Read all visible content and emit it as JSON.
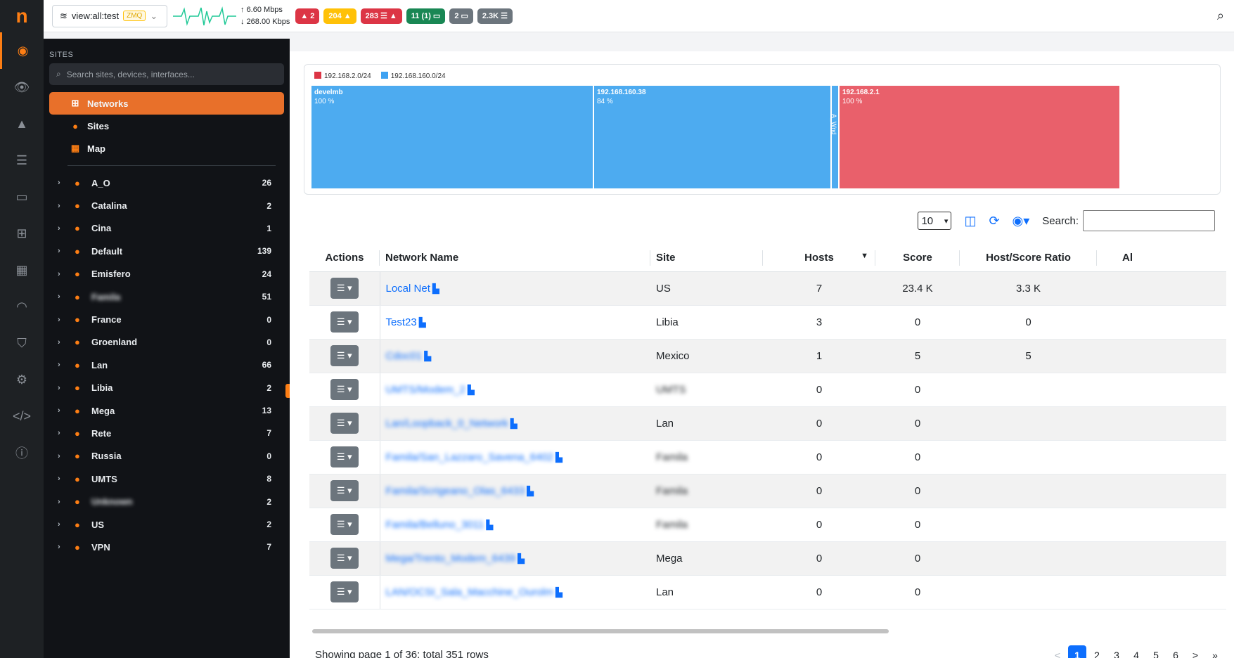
{
  "app": {
    "logo": "n"
  },
  "topbar": {
    "view": "view:all:test",
    "zmq": "ZMQ",
    "upload": "6.60 Mbps",
    "download": "268.00 Kbps",
    "badges": [
      "2",
      "204",
      "283",
      "11 (1)",
      "2",
      "2.3K"
    ]
  },
  "sidebar": {
    "title": "SITES",
    "search_placeholder": "Search sites, devices, interfaces...",
    "menu": [
      {
        "label": "Networks",
        "icon": "network-icon"
      },
      {
        "label": "Sites",
        "icon": "location-icon"
      },
      {
        "label": "Map",
        "icon": "map-icon"
      }
    ],
    "sites": [
      {
        "name": "A_O",
        "count": "26"
      },
      {
        "name": "Catalina",
        "count": "2"
      },
      {
        "name": "Cina",
        "count": "1"
      },
      {
        "name": "Default",
        "count": "139"
      },
      {
        "name": "Emisfero",
        "count": "24"
      },
      {
        "name": "Famila",
        "count": "51",
        "blurred": true
      },
      {
        "name": "France",
        "count": "0"
      },
      {
        "name": "Groenland",
        "count": "0"
      },
      {
        "name": "Lan",
        "count": "66"
      },
      {
        "name": "Libia",
        "count": "2"
      },
      {
        "name": "Mega",
        "count": "13"
      },
      {
        "name": "Rete",
        "count": "7"
      },
      {
        "name": "Russia",
        "count": "0"
      },
      {
        "name": "UMTS",
        "count": "8"
      },
      {
        "name": "Unknown",
        "count": "2",
        "blurred": true
      },
      {
        "name": "US",
        "count": "2"
      },
      {
        "name": "VPN",
        "count": "7"
      }
    ]
  },
  "treemap": {
    "legend": [
      {
        "label": "192.168.2.0/24",
        "color": "#dc3545"
      },
      {
        "label": "192.168.160.0/24",
        "color": "#3ea2f2"
      }
    ],
    "cells": [
      {
        "name": "develmb",
        "pct": "100 %",
        "color": "#4dabf0"
      },
      {
        "name": "192.168.160.38",
        "pct": "84 %",
        "color": "#4dabf0"
      },
      {
        "name": "A_Wnd",
        "pct": "",
        "color": "#4dabf0"
      },
      {
        "name": "192.168.2.1",
        "pct": "100 %",
        "color": "#e9606b"
      }
    ]
  },
  "controls": {
    "page_size": "10",
    "search_label": "Search:"
  },
  "table": {
    "headers": [
      "Actions",
      "Network Name",
      "Site",
      "Hosts",
      "Score",
      "Host/Score Ratio",
      "Al"
    ],
    "rows": [
      {
        "name": "Local Net",
        "site": "US",
        "hosts": "7",
        "score": "23.4 K",
        "ratio": "3.3 K"
      },
      {
        "name": "Test23",
        "site": "Libia",
        "hosts": "3",
        "score": "0",
        "ratio": "0"
      },
      {
        "name": "Cdoc01",
        "site": "Mexico",
        "hosts": "1",
        "score": "5",
        "ratio": "5",
        "blur_name": true
      },
      {
        "name": "UMTS/Modem_2",
        "site": "UMTS",
        "hosts": "0",
        "score": "0",
        "ratio": "",
        "blur_name": true,
        "blur_site": true
      },
      {
        "name": "Lan/Loopback_0_Network",
        "site": "Lan",
        "hosts": "0",
        "score": "0",
        "ratio": "",
        "blur_name": true
      },
      {
        "name": "Famila/San_Lazzaro_Savena_6402",
        "site": "Famila",
        "hosts": "0",
        "score": "0",
        "ratio": "",
        "blur_name": true,
        "blur_site": true
      },
      {
        "name": "Famila/Scrigeano_Olas_6433",
        "site": "Famila",
        "hosts": "0",
        "score": "0",
        "ratio": "",
        "blur_name": true,
        "blur_site": true
      },
      {
        "name": "Famila/Belluno_3011",
        "site": "Famila",
        "hosts": "0",
        "score": "0",
        "ratio": "",
        "blur_name": true,
        "blur_site": true
      },
      {
        "name": "Mega/Trento_Modem_6439",
        "site": "Mega",
        "hosts": "0",
        "score": "0",
        "ratio": "",
        "blur_name": true
      },
      {
        "name": "LAN/OCSI_Sala_Macchine_Ourolm",
        "site": "Lan",
        "hosts": "0",
        "score": "0",
        "ratio": "",
        "blur_name": true
      }
    ]
  },
  "footer": {
    "summary": "Showing page 1 of 36: total 351 rows",
    "pages": [
      "<",
      "1",
      "2",
      "3",
      "4",
      "5",
      "6",
      ">",
      "»"
    ]
  }
}
